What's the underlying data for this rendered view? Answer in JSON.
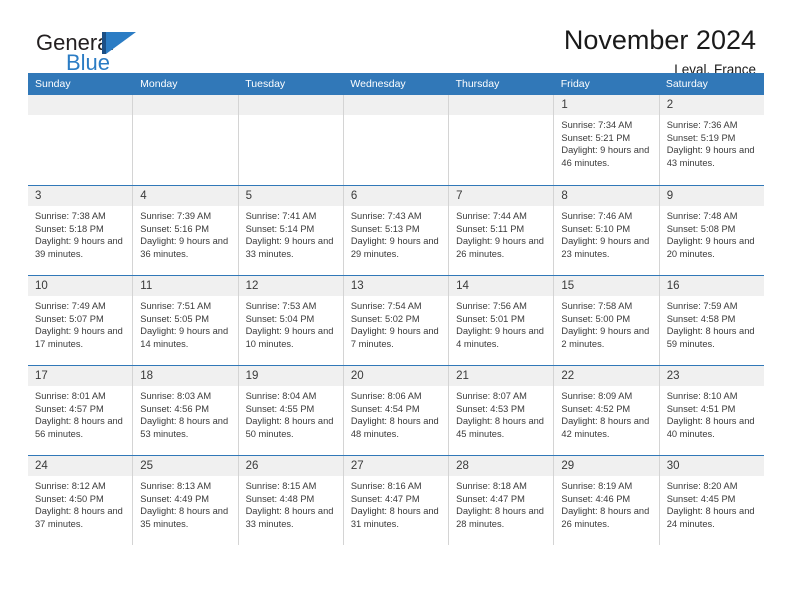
{
  "brand": {
    "name_part1": "General",
    "name_part2": "Blue",
    "logo_icon": "general-blue-triangle-logo"
  },
  "header": {
    "month_title": "November 2024",
    "location": "Leval, France"
  },
  "colors": {
    "header_blue": "#3178b8",
    "brand_blue": "#2b7cc4",
    "brand_dark_blue": "#1b4f86",
    "day_band_gray": "#f0f0f0",
    "grid_line": "#d4d4d4",
    "text": "#3a3a3a"
  },
  "calendar": {
    "weekdays": [
      "Sunday",
      "Monday",
      "Tuesday",
      "Wednesday",
      "Thursday",
      "Friday",
      "Saturday"
    ],
    "weeks": [
      [
        {
          "day": "",
          "empty": true
        },
        {
          "day": "",
          "empty": true
        },
        {
          "day": "",
          "empty": true
        },
        {
          "day": "",
          "empty": true
        },
        {
          "day": "",
          "empty": true
        },
        {
          "day": "1",
          "sunrise": "Sunrise: 7:34 AM",
          "sunset": "Sunset: 5:21 PM",
          "daylight": "Daylight: 9 hours and 46 minutes."
        },
        {
          "day": "2",
          "sunrise": "Sunrise: 7:36 AM",
          "sunset": "Sunset: 5:19 PM",
          "daylight": "Daylight: 9 hours and 43 minutes."
        }
      ],
      [
        {
          "day": "3",
          "sunrise": "Sunrise: 7:38 AM",
          "sunset": "Sunset: 5:18 PM",
          "daylight": "Daylight: 9 hours and 39 minutes."
        },
        {
          "day": "4",
          "sunrise": "Sunrise: 7:39 AM",
          "sunset": "Sunset: 5:16 PM",
          "daylight": "Daylight: 9 hours and 36 minutes."
        },
        {
          "day": "5",
          "sunrise": "Sunrise: 7:41 AM",
          "sunset": "Sunset: 5:14 PM",
          "daylight": "Daylight: 9 hours and 33 minutes."
        },
        {
          "day": "6",
          "sunrise": "Sunrise: 7:43 AM",
          "sunset": "Sunset: 5:13 PM",
          "daylight": "Daylight: 9 hours and 29 minutes."
        },
        {
          "day": "7",
          "sunrise": "Sunrise: 7:44 AM",
          "sunset": "Sunset: 5:11 PM",
          "daylight": "Daylight: 9 hours and 26 minutes."
        },
        {
          "day": "8",
          "sunrise": "Sunrise: 7:46 AM",
          "sunset": "Sunset: 5:10 PM",
          "daylight": "Daylight: 9 hours and 23 minutes."
        },
        {
          "day": "9",
          "sunrise": "Sunrise: 7:48 AM",
          "sunset": "Sunset: 5:08 PM",
          "daylight": "Daylight: 9 hours and 20 minutes."
        }
      ],
      [
        {
          "day": "10",
          "sunrise": "Sunrise: 7:49 AM",
          "sunset": "Sunset: 5:07 PM",
          "daylight": "Daylight: 9 hours and 17 minutes."
        },
        {
          "day": "11",
          "sunrise": "Sunrise: 7:51 AM",
          "sunset": "Sunset: 5:05 PM",
          "daylight": "Daylight: 9 hours and 14 minutes."
        },
        {
          "day": "12",
          "sunrise": "Sunrise: 7:53 AM",
          "sunset": "Sunset: 5:04 PM",
          "daylight": "Daylight: 9 hours and 10 minutes."
        },
        {
          "day": "13",
          "sunrise": "Sunrise: 7:54 AM",
          "sunset": "Sunset: 5:02 PM",
          "daylight": "Daylight: 9 hours and 7 minutes."
        },
        {
          "day": "14",
          "sunrise": "Sunrise: 7:56 AM",
          "sunset": "Sunset: 5:01 PM",
          "daylight": "Daylight: 9 hours and 4 minutes."
        },
        {
          "day": "15",
          "sunrise": "Sunrise: 7:58 AM",
          "sunset": "Sunset: 5:00 PM",
          "daylight": "Daylight: 9 hours and 2 minutes."
        },
        {
          "day": "16",
          "sunrise": "Sunrise: 7:59 AM",
          "sunset": "Sunset: 4:58 PM",
          "daylight": "Daylight: 8 hours and 59 minutes."
        }
      ],
      [
        {
          "day": "17",
          "sunrise": "Sunrise: 8:01 AM",
          "sunset": "Sunset: 4:57 PM",
          "daylight": "Daylight: 8 hours and 56 minutes."
        },
        {
          "day": "18",
          "sunrise": "Sunrise: 8:03 AM",
          "sunset": "Sunset: 4:56 PM",
          "daylight": "Daylight: 8 hours and 53 minutes."
        },
        {
          "day": "19",
          "sunrise": "Sunrise: 8:04 AM",
          "sunset": "Sunset: 4:55 PM",
          "daylight": "Daylight: 8 hours and 50 minutes."
        },
        {
          "day": "20",
          "sunrise": "Sunrise: 8:06 AM",
          "sunset": "Sunset: 4:54 PM",
          "daylight": "Daylight: 8 hours and 48 minutes."
        },
        {
          "day": "21",
          "sunrise": "Sunrise: 8:07 AM",
          "sunset": "Sunset: 4:53 PM",
          "daylight": "Daylight: 8 hours and 45 minutes."
        },
        {
          "day": "22",
          "sunrise": "Sunrise: 8:09 AM",
          "sunset": "Sunset: 4:52 PM",
          "daylight": "Daylight: 8 hours and 42 minutes."
        },
        {
          "day": "23",
          "sunrise": "Sunrise: 8:10 AM",
          "sunset": "Sunset: 4:51 PM",
          "daylight": "Daylight: 8 hours and 40 minutes."
        }
      ],
      [
        {
          "day": "24",
          "sunrise": "Sunrise: 8:12 AM",
          "sunset": "Sunset: 4:50 PM",
          "daylight": "Daylight: 8 hours and 37 minutes."
        },
        {
          "day": "25",
          "sunrise": "Sunrise: 8:13 AM",
          "sunset": "Sunset: 4:49 PM",
          "daylight": "Daylight: 8 hours and 35 minutes."
        },
        {
          "day": "26",
          "sunrise": "Sunrise: 8:15 AM",
          "sunset": "Sunset: 4:48 PM",
          "daylight": "Daylight: 8 hours and 33 minutes."
        },
        {
          "day": "27",
          "sunrise": "Sunrise: 8:16 AM",
          "sunset": "Sunset: 4:47 PM",
          "daylight": "Daylight: 8 hours and 31 minutes."
        },
        {
          "day": "28",
          "sunrise": "Sunrise: 8:18 AM",
          "sunset": "Sunset: 4:47 PM",
          "daylight": "Daylight: 8 hours and 28 minutes."
        },
        {
          "day": "29",
          "sunrise": "Sunrise: 8:19 AM",
          "sunset": "Sunset: 4:46 PM",
          "daylight": "Daylight: 8 hours and 26 minutes."
        },
        {
          "day": "30",
          "sunrise": "Sunrise: 8:20 AM",
          "sunset": "Sunset: 4:45 PM",
          "daylight": "Daylight: 8 hours and 24 minutes."
        }
      ]
    ]
  }
}
